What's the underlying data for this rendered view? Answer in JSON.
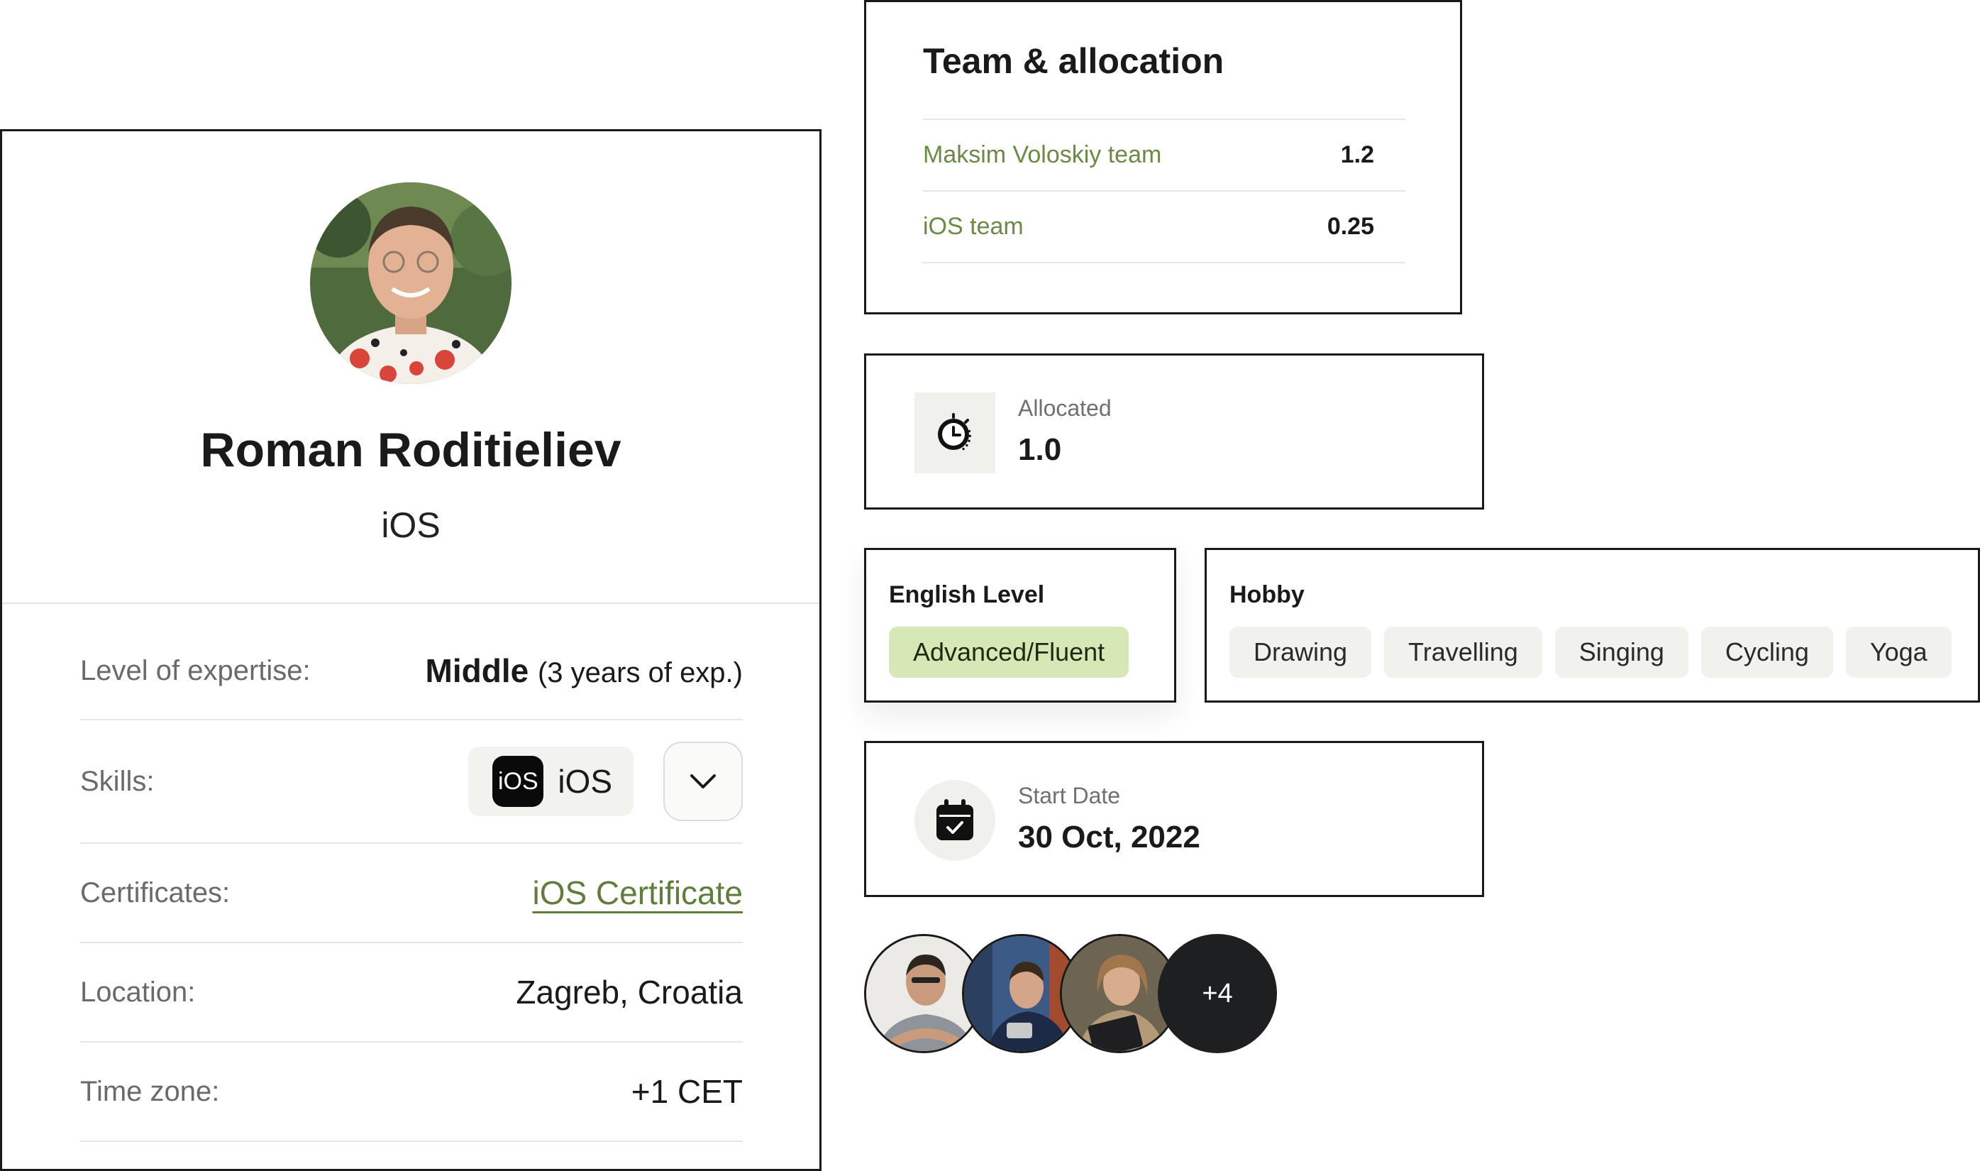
{
  "profile": {
    "name": "Roman Roditieliev",
    "role": "iOS",
    "details": {
      "expertise_label": "Level of expertise:",
      "expertise_level": "Middle",
      "expertise_years": "(3 years of exp.)",
      "skills_label": "Skills:",
      "skill_badge": "iOS",
      "skill_name": "iOS",
      "certificates_label": "Certificates:",
      "certificate_link": "iOS Certificate",
      "location_label": "Location:",
      "location_value": "Zagreb, Croatia",
      "timezone_label": "Time zone:",
      "timezone_value": "+1 CET"
    }
  },
  "team": {
    "title": "Team & allocation",
    "rows": [
      {
        "name": "Maksim Voloskiy team",
        "value": "1.2"
      },
      {
        "name": "iOS team",
        "value": "0.25"
      }
    ]
  },
  "allocated": {
    "label": "Allocated",
    "value": "1.0",
    "icon": "clock-icon"
  },
  "english": {
    "title": "English Level",
    "level": "Advanced/Fluent"
  },
  "hobby": {
    "title": "Hobby",
    "items": [
      "Drawing",
      "Travelling",
      "Singing",
      "Cycling",
      "Yoga"
    ]
  },
  "start_date": {
    "label": "Start Date",
    "value": "30 Oct, 2022",
    "icon": "calendar-check-icon"
  },
  "members": {
    "more_label": "+4"
  },
  "colors": {
    "accent_green": "#5f7d3c",
    "pill_green": "#d5e8b6",
    "border": "#1a1a1a"
  }
}
